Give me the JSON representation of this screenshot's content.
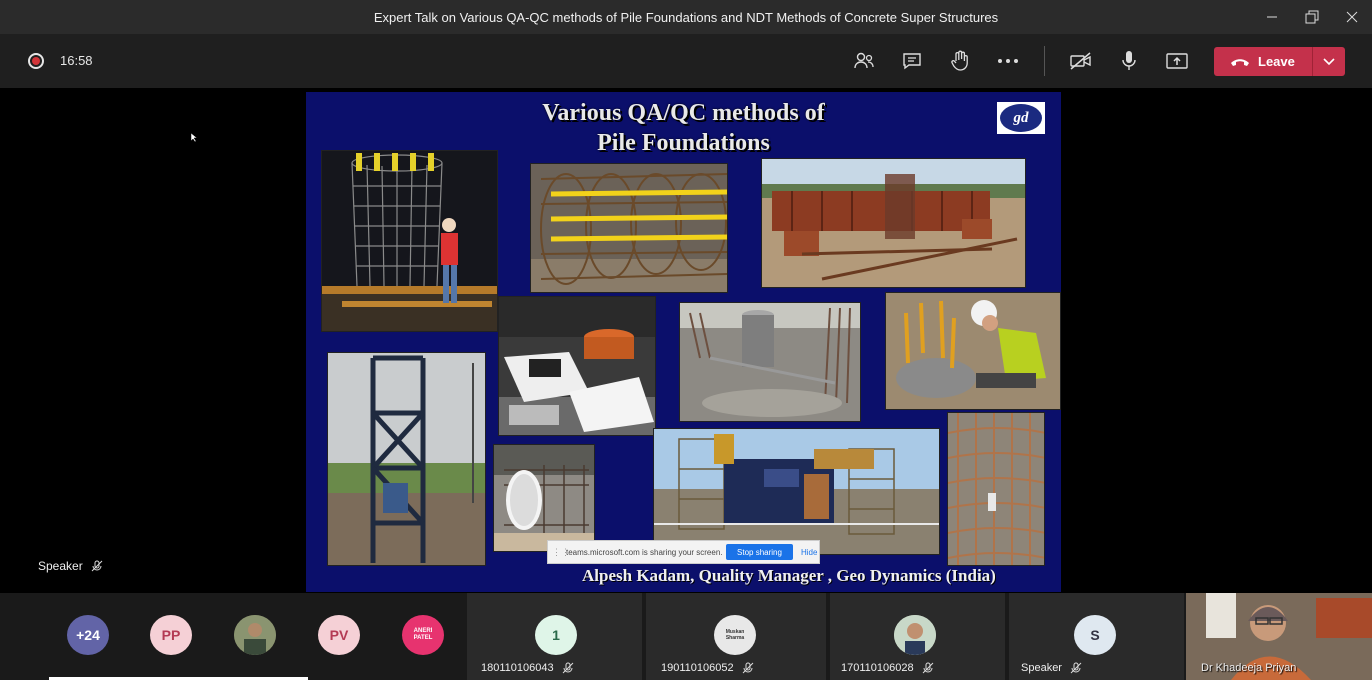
{
  "window": {
    "title": "Expert Talk on Various QA-QC methods of Pile Foundations and NDT Methods of Concrete Super Structures"
  },
  "toolbar": {
    "timer": "16:58",
    "leave_label": "Leave"
  },
  "slide": {
    "title_line1": "Various QA/QC methods of",
    "title_line2": "Pile Foundations",
    "logo_text": "gd",
    "footer": "Alpesh Kadam, Quality Manager , Geo Dynamics (India)"
  },
  "share_bar": {
    "message": "teams.microsoft.com is sharing your screen.",
    "stop_label": "Stop sharing",
    "hide_label": "Hide"
  },
  "stage": {
    "speaker_label": "Speaker"
  },
  "participants": {
    "overflow": "+24",
    "avatars": [
      {
        "initials": "PP",
        "color": "#f5d0d6"
      },
      {
        "initials": "PV",
        "color": "#f5d0d6"
      },
      {
        "initials": "ANERI PATEL",
        "color": "#e7336f"
      }
    ],
    "tiles": [
      {
        "avatar": "1",
        "label": "180110106043"
      },
      {
        "avatar": "Muskan Sharma",
        "label": "190110106052"
      },
      {
        "avatar": "",
        "label": "170110106028"
      },
      {
        "avatar": "S",
        "label": "Speaker"
      }
    ],
    "video_name": "Dr Khadeeja Priyan"
  },
  "colors": {
    "leave": "#c4314b",
    "slide_bg": "#0b0f6b",
    "toolbar_bg": "#1f1f1f",
    "titlebar_bg": "#2b2b2b"
  }
}
